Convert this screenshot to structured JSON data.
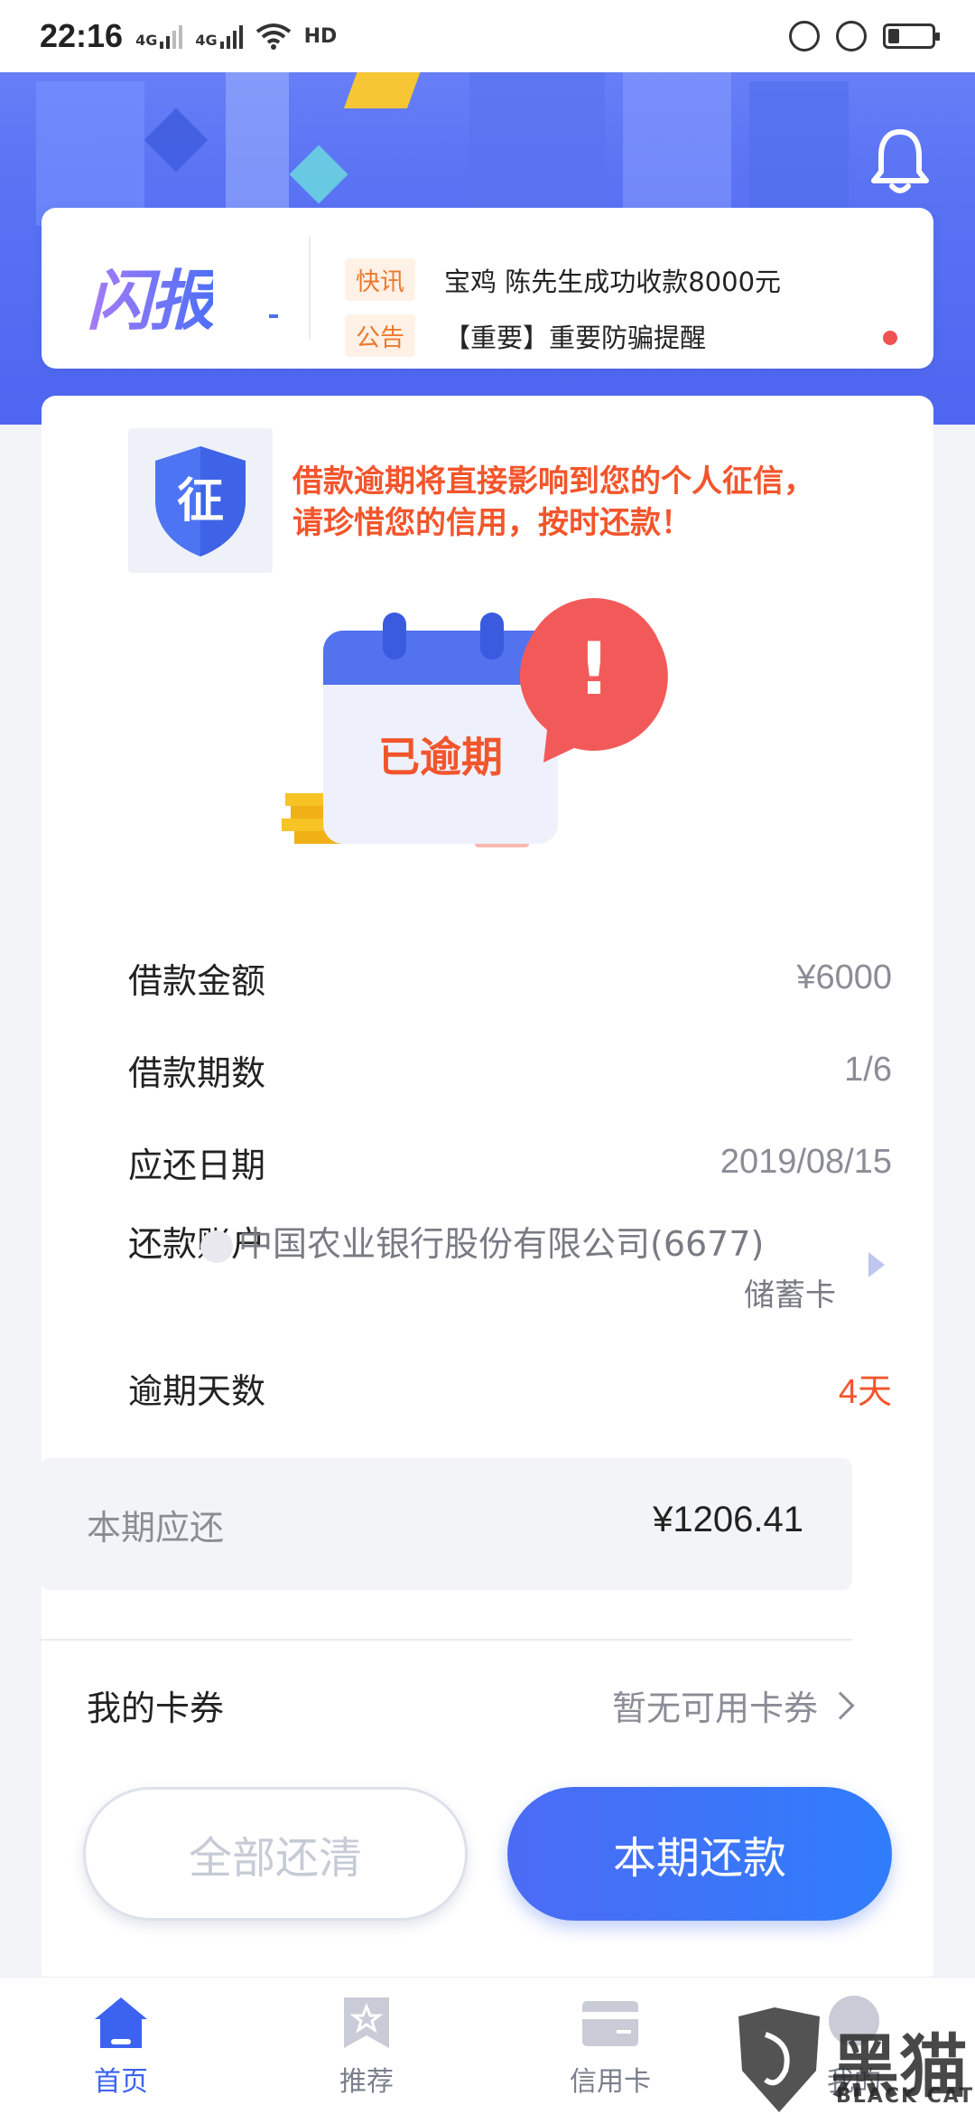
{
  "status_bar": {
    "time": "22:16",
    "signal1": "4G",
    "signal2": "4G",
    "hd": "HD",
    "battery_level": 0.25
  },
  "news": {
    "logo": "闪报",
    "items": [
      {
        "tag": "快讯",
        "text": "宝鸡 陈先生成功收款8000元"
      },
      {
        "tag": "公告",
        "text": "【重要】重要防骗提醒"
      }
    ]
  },
  "credit": {
    "icon_char": "征",
    "warning_line1": "借款逾期将直接影响到您的个人征信，",
    "warning_line2": "请珍惜您的信用，按时还款！"
  },
  "status_illustration": {
    "label": "已逾期",
    "alert_mark": "!"
  },
  "loan": {
    "amount_label": "借款金额",
    "amount_value": "¥6000",
    "periods_label": "借款期数",
    "periods_value": "1/6",
    "due_date_label": "应还日期",
    "due_date_value": "2019/08/15",
    "account_label": "还款账户",
    "account_bank": "中国农业银行股份有限公司(6677)",
    "account_type": "储蓄卡",
    "overdue_label": "逾期天数",
    "overdue_value": "4天"
  },
  "due": {
    "label": "本期应还",
    "value": "¥1206.41"
  },
  "coupon": {
    "label": "我的卡券",
    "value": "暂无可用卡券"
  },
  "buttons": {
    "pay_all": "全部还清",
    "pay_current": "本期还款"
  },
  "tabs": [
    {
      "label": "首页",
      "icon": "home-icon",
      "active": true
    },
    {
      "label": "推荐",
      "icon": "star-bookmark-icon",
      "active": false
    },
    {
      "label": "信用卡",
      "icon": "credit-card-icon",
      "active": false
    },
    {
      "label": "我的",
      "icon": "user-icon",
      "active": false
    }
  ],
  "watermark": {
    "title": "黑猫",
    "subtitle": "BLACK CAT"
  },
  "colors": {
    "accent": "#3c63f0",
    "warning": "#f2552c"
  }
}
